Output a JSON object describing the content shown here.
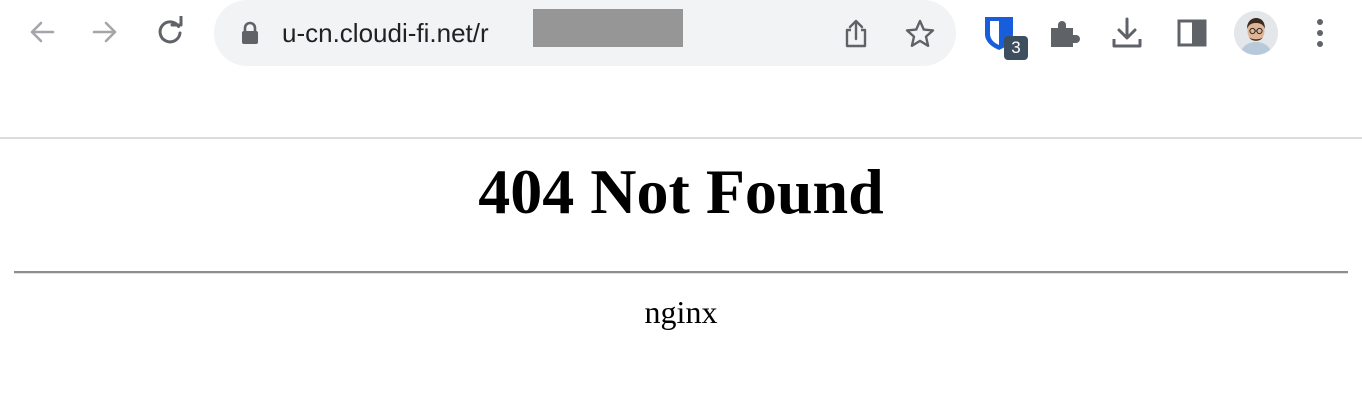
{
  "browser": {
    "url_text": "u-cn.cloudi-fi.net/r",
    "nav_icons": [
      "back-arrow-icon",
      "forward-arrow-icon",
      "reload-icon"
    ],
    "omnibox_icons": [
      "lock-icon",
      "share-icon",
      "star-icon"
    ],
    "extensions": {
      "bitwarden_badge": "3",
      "icons": [
        "bitwarden-icon",
        "puzzle-icon",
        "download-icon",
        "side-panel-icon",
        "avatar",
        "kebab-menu-icon"
      ]
    },
    "colors": {
      "toolbar_bg": "#ffffff",
      "omnibox_bg": "#f1f3f4",
      "icon": "#5f6368",
      "icon_disabled": "#a4a6a9",
      "bitwarden_blue": "#175ddc",
      "badge_bg": "#3d4f5f",
      "redaction": "#969696"
    }
  },
  "page": {
    "heading": "404 Not Found",
    "server": "nginx"
  }
}
